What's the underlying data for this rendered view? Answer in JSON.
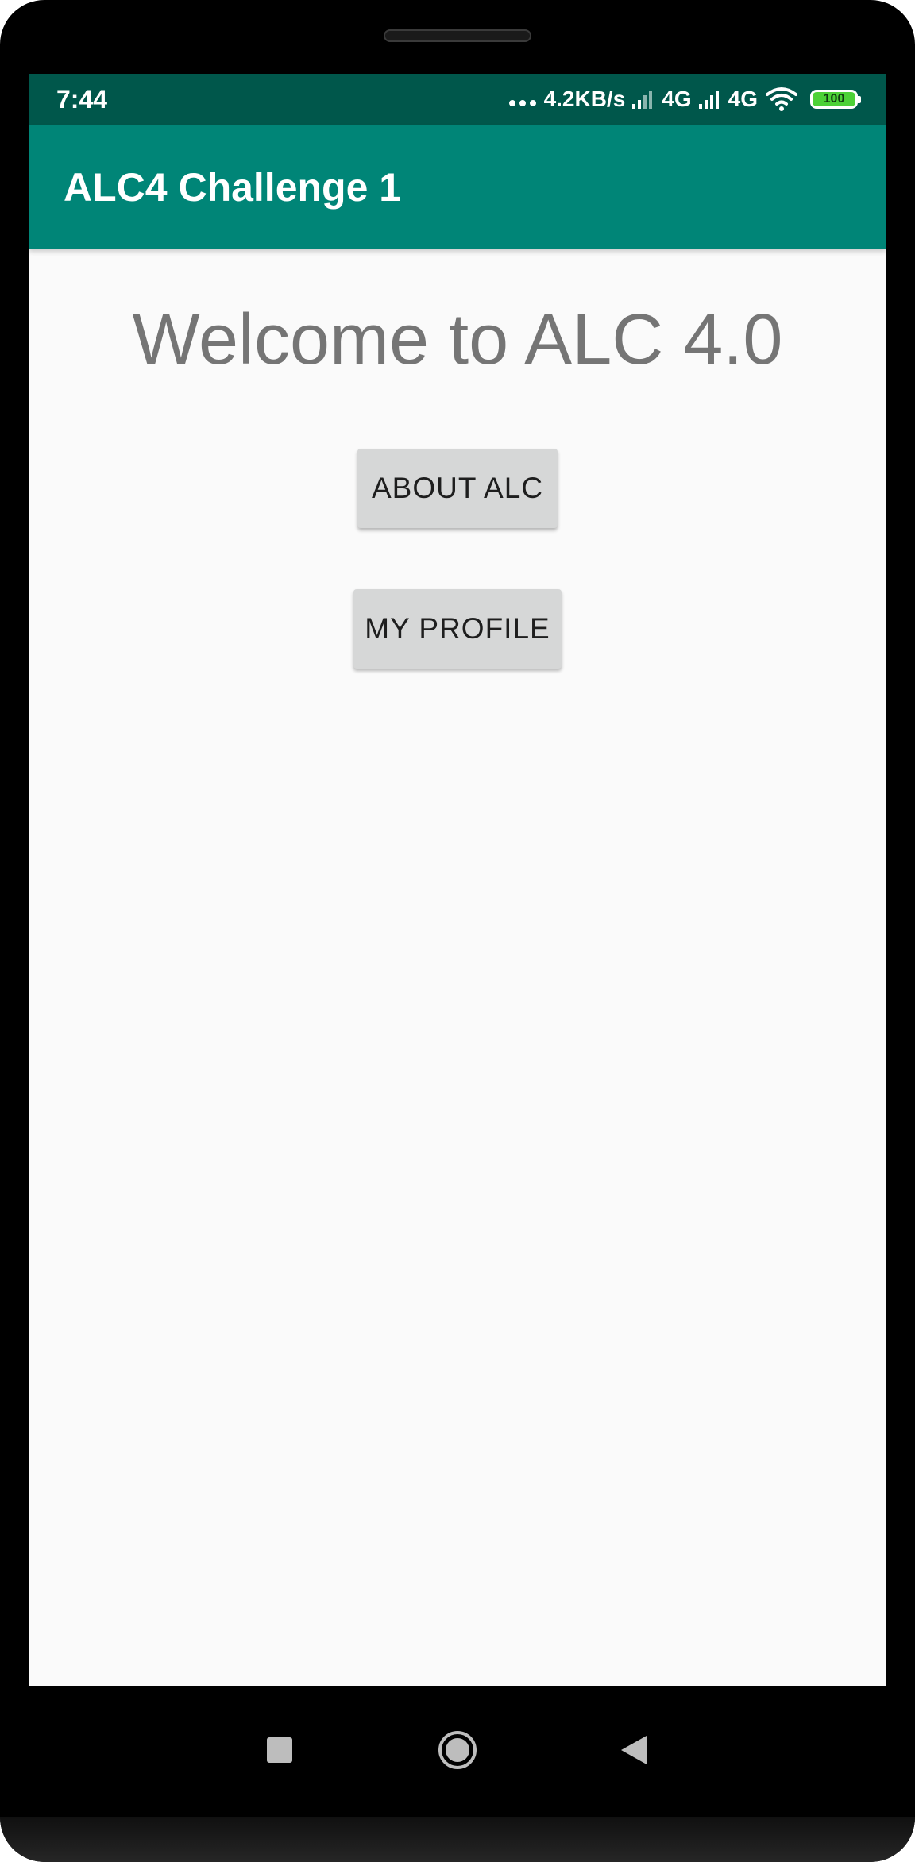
{
  "status_bar": {
    "time": "7:44",
    "network_speed": "4.2KB/s",
    "network_1": "4G",
    "network_2": "4G",
    "battery": "100",
    "icons": [
      "more-dots-icon",
      "signal-icon",
      "signal-icon",
      "wifi-icon",
      "battery-icon"
    ]
  },
  "app_bar": {
    "title": "ALC4 Challenge 1"
  },
  "main": {
    "welcome": "Welcome to ALC 4.0",
    "about_button": "ABOUT ALC",
    "profile_button": "MY PROFILE"
  },
  "nav_bar": {
    "icons": [
      "recents-square-icon",
      "home-circle-icon",
      "back-triangle-icon"
    ]
  },
  "colors": {
    "status_bar": "#00574b",
    "app_bar": "#008577",
    "background": "#fafafa",
    "button": "#d6d7d7",
    "welcome_text": "#757575"
  }
}
